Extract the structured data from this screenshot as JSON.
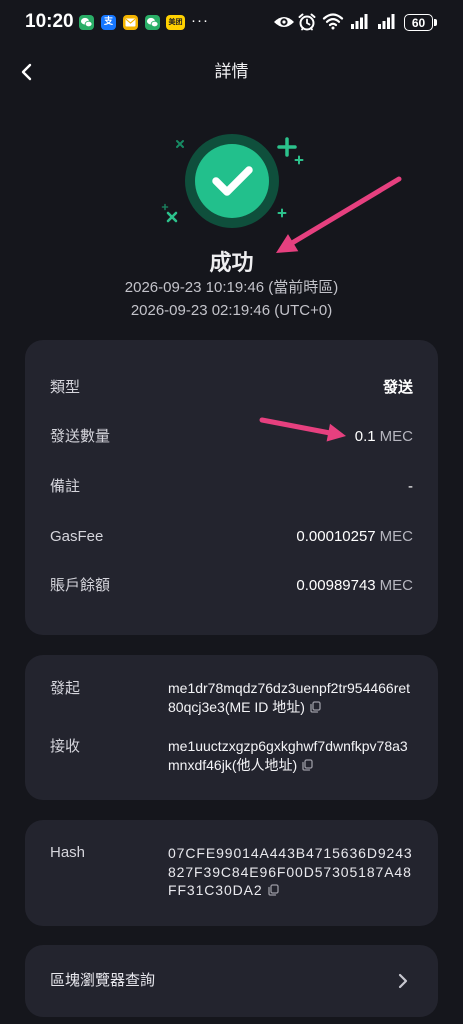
{
  "status_bar": {
    "time": "10:20",
    "notification_icons": [
      "wechat-icon",
      "alipay-icon",
      "mail-icon",
      "wechat-icon",
      "meituan-icon"
    ],
    "alipay_glyph": "支",
    "meituan_glyph": "美团",
    "more": "···",
    "system_icons": [
      "eye-icon",
      "alarm-icon",
      "wifi-icon",
      "signal-icon",
      "signal-icon",
      "battery-icon"
    ],
    "battery_level": "60"
  },
  "header": {
    "back_icon": "chevron-left-icon",
    "title": "詳情"
  },
  "result": {
    "icon": "success-check-icon",
    "status": "成功",
    "time_local": "2026-09-23 10:19:46 (當前時區)",
    "time_utc": "2026-09-23 02:19:46 (UTC+0)"
  },
  "summary": {
    "rows": [
      {
        "label": "類型",
        "value": "發送"
      },
      {
        "label": "發送數量",
        "value": "0.1",
        "unit": "MEC"
      },
      {
        "label": "備註",
        "value": "-"
      },
      {
        "label": "GasFee",
        "value": "0.00010257",
        "unit": "MEC"
      },
      {
        "label": "賬戶餘額",
        "value": "0.00989743",
        "unit": "MEC"
      }
    ]
  },
  "parties": {
    "from": {
      "label": "發起",
      "address": "me1dr78mqdz76dz3uenpf2tr954466ret80qcj3e3",
      "tag": "(ME ID 地址)",
      "copy_icon": "copy-icon"
    },
    "to": {
      "label": "接收",
      "address": "me1uuctzxgzp6gxkghwf7dwnfkpv78a3mnxdf46jk",
      "tag": "(他人地址)",
      "copy_icon": "copy-icon"
    }
  },
  "hash": {
    "label": "Hash",
    "value": "07CFE99014A443B4715636D9243827F39C84E96F00D57305187A48FF31C30DA2",
    "copy_icon": "copy-icon"
  },
  "explorer": {
    "label": "區塊瀏覽器查詢",
    "icon": "chevron-right-icon"
  },
  "colors": {
    "background": "#15161c",
    "card": "#23242e",
    "success_green": "#22c08c",
    "annotation_pink": "#e6407f"
  }
}
